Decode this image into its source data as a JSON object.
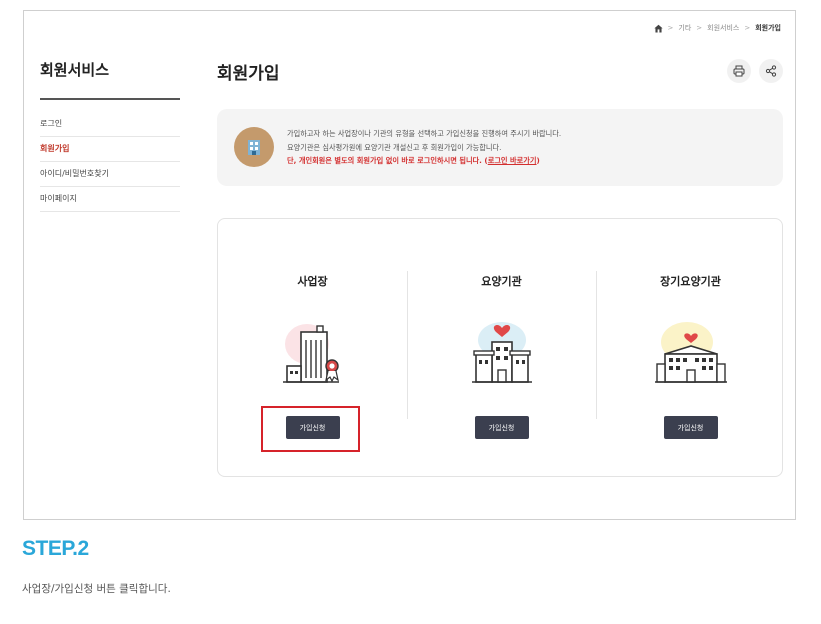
{
  "breadcrumb": {
    "items": [
      "기타",
      "회원서비스"
    ],
    "current": "회원가입"
  },
  "sidebar": {
    "title": "회원서비스",
    "items": [
      {
        "label": "로그인"
      },
      {
        "label": "회원가입"
      },
      {
        "label": "아이디/비밀번호찾기"
      },
      {
        "label": "마이페이지"
      }
    ]
  },
  "main": {
    "title": "회원가입",
    "notice": {
      "line1": "가입하고자 하는 사업장이나 기관의 유형을 선택하고 가입신청을 진행하여 주시기 바랍니다.",
      "line2": "요양기관은 심사평가원에 요양기관 개설신고 후 회원가입이 가능합니다.",
      "line3": "단, 개인회원은 별도의 회원가입 없이 바로 로그인하시면 됩니다. (",
      "link": "로그인 바로가기",
      "line3_end": ")"
    },
    "cards": [
      {
        "title": "사업장",
        "button": "가입신청"
      },
      {
        "title": "요양기관",
        "button": "가입신청"
      },
      {
        "title": "장기요양기관",
        "button": "가입신청"
      }
    ]
  },
  "caption": {
    "step": "STEP.2",
    "description": "사업장/가입신청 버튼 클릭합니다."
  },
  "colors": {
    "accent": "#2aa7d9",
    "highlight": "#d6232a",
    "button": "#3b3f4f",
    "active": "#c0392b"
  }
}
